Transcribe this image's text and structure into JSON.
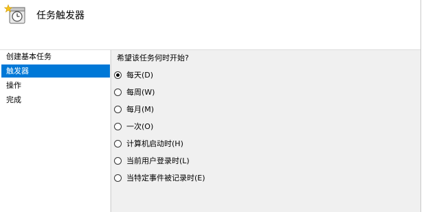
{
  "header": {
    "title": "任务触发器",
    "icon": "task-clock-icon"
  },
  "sidebar": {
    "items": [
      {
        "label": "创建基本任务",
        "selected": false
      },
      {
        "label": "触发器",
        "selected": true
      },
      {
        "label": "操作",
        "selected": false
      },
      {
        "label": "完成",
        "selected": false
      }
    ]
  },
  "main": {
    "question": "希望该任务何时开始?",
    "options": [
      {
        "label": "每天(D)",
        "checked": true
      },
      {
        "label": "每周(W)",
        "checked": false
      },
      {
        "label": "每月(M)",
        "checked": false
      },
      {
        "label": "一次(O)",
        "checked": false
      },
      {
        "label": "计算机启动时(H)",
        "checked": false
      },
      {
        "label": "当前用户登录时(L)",
        "checked": false
      },
      {
        "label": "当特定事件被记录时(E)",
        "checked": false
      }
    ]
  },
  "colors": {
    "selection": "#0078d7",
    "panel": "#f0f0f0",
    "header": "#ffffff"
  }
}
